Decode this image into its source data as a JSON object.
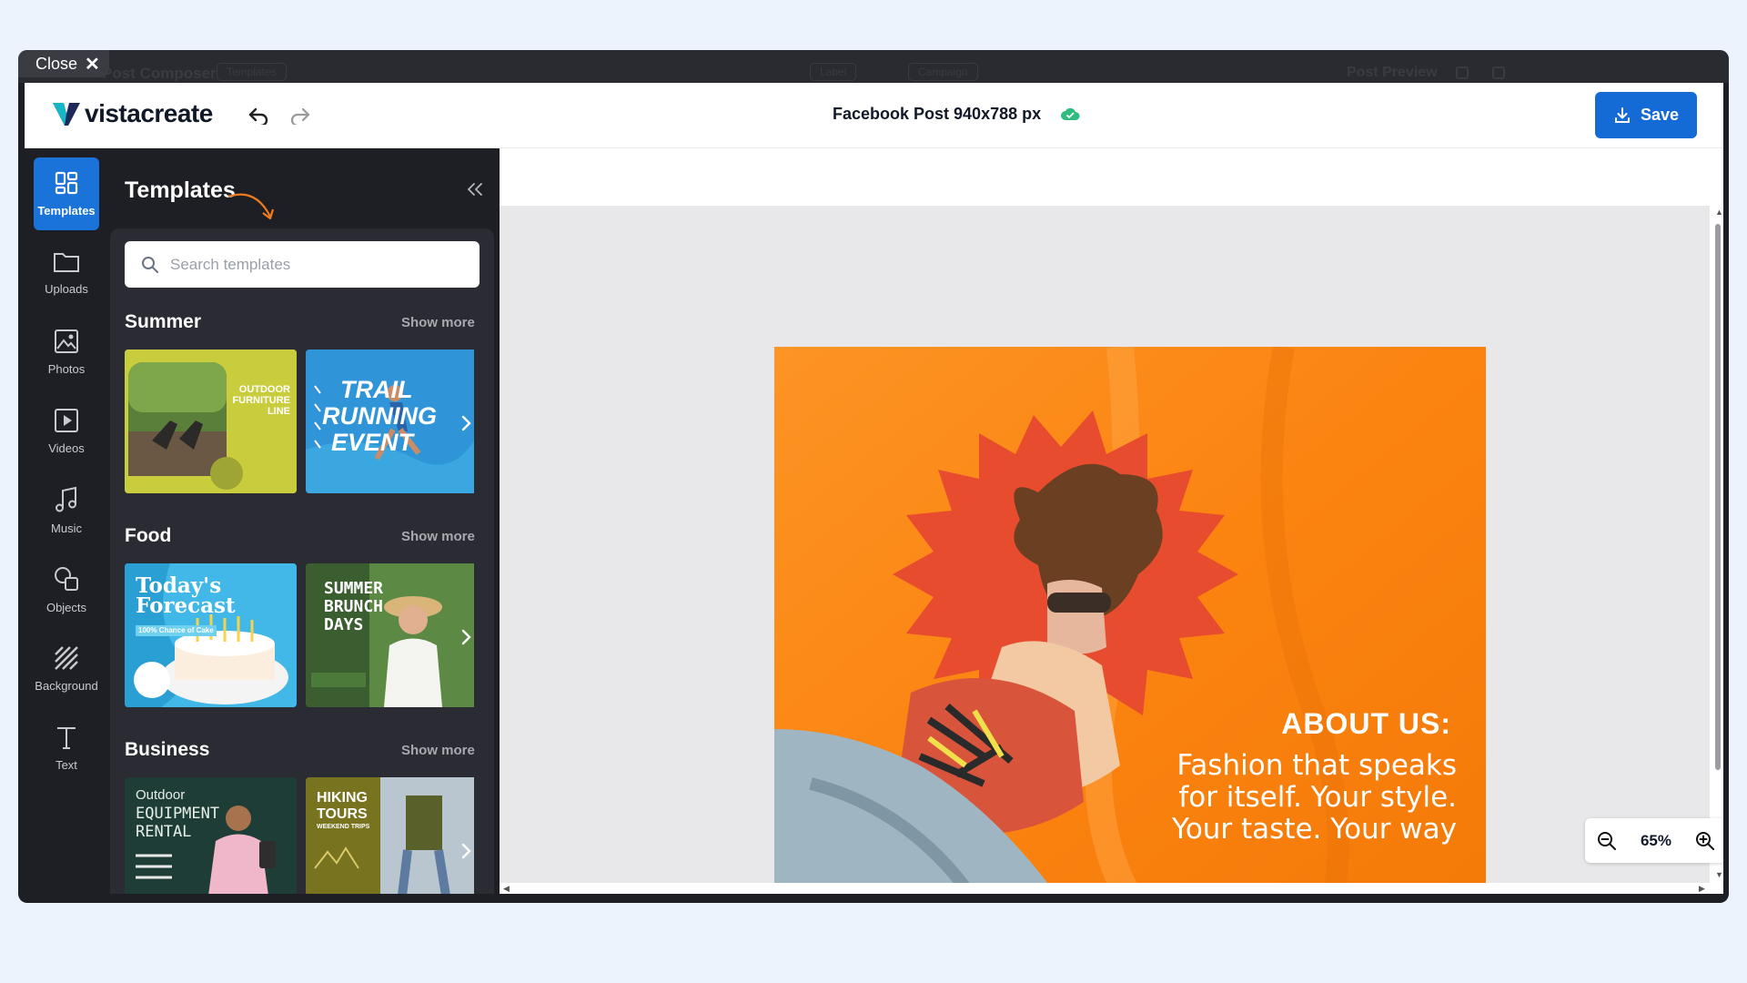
{
  "window": {
    "close_label": "Close",
    "bg_title": "Post Composer",
    "bg_templates_chip": "Templates",
    "bg_label_chip": "Label",
    "bg_campaign_chip": "Campaign",
    "bg_preview": "Post Preview"
  },
  "header": {
    "logo_text": "vistacreate",
    "doc_title": "Facebook Post 940x788 px",
    "save_label": "Save"
  },
  "rail": {
    "items": [
      {
        "label": "Templates",
        "icon": "templates-icon"
      },
      {
        "label": "Uploads",
        "icon": "folder-icon"
      },
      {
        "label": "Photos",
        "icon": "image-icon"
      },
      {
        "label": "Videos",
        "icon": "video-icon"
      },
      {
        "label": "Music",
        "icon": "music-icon"
      },
      {
        "label": "Objects",
        "icon": "shapes-icon"
      },
      {
        "label": "Background",
        "icon": "pattern-icon"
      },
      {
        "label": "Text",
        "icon": "text-icon"
      }
    ]
  },
  "panel": {
    "title": "Templates",
    "search_placeholder": "Search templates",
    "sections": [
      {
        "title": "Summer",
        "show_more": "Show more",
        "thumbs": [
          {
            "line1": "OUTDOOR",
            "line2": "FURNITURE",
            "line3": "LINE"
          },
          {
            "line1": "TRAIL",
            "line2": "RUNNING",
            "line3": "EVENT"
          }
        ]
      },
      {
        "title": "Food",
        "show_more": "Show more",
        "thumbs": [
          {
            "line1": "Today's",
            "line2": "Forecast",
            "line3": "100% Chance of Cake"
          },
          {
            "line1": "SUMMER",
            "line2": "BRUNCH",
            "line3": "DAYS"
          }
        ]
      },
      {
        "title": "Business",
        "show_more": "Show more",
        "thumbs": [
          {
            "line1": "Outdoor",
            "line2": "EQUIPMENT",
            "line3": "RENTAL"
          },
          {
            "line1": "HIKING",
            "line2": "TOURS",
            "line3": "WEEKEND TRIPS"
          }
        ]
      }
    ]
  },
  "canvas": {
    "heading": "ABOUT US:",
    "body": "Fashion that speaks for itself. Your style. Your taste. Your way",
    "zoom": "65%"
  },
  "colors": {
    "accent": "#146bd6",
    "post_orange": "#fb8512",
    "starburst": "#e84c2e"
  }
}
